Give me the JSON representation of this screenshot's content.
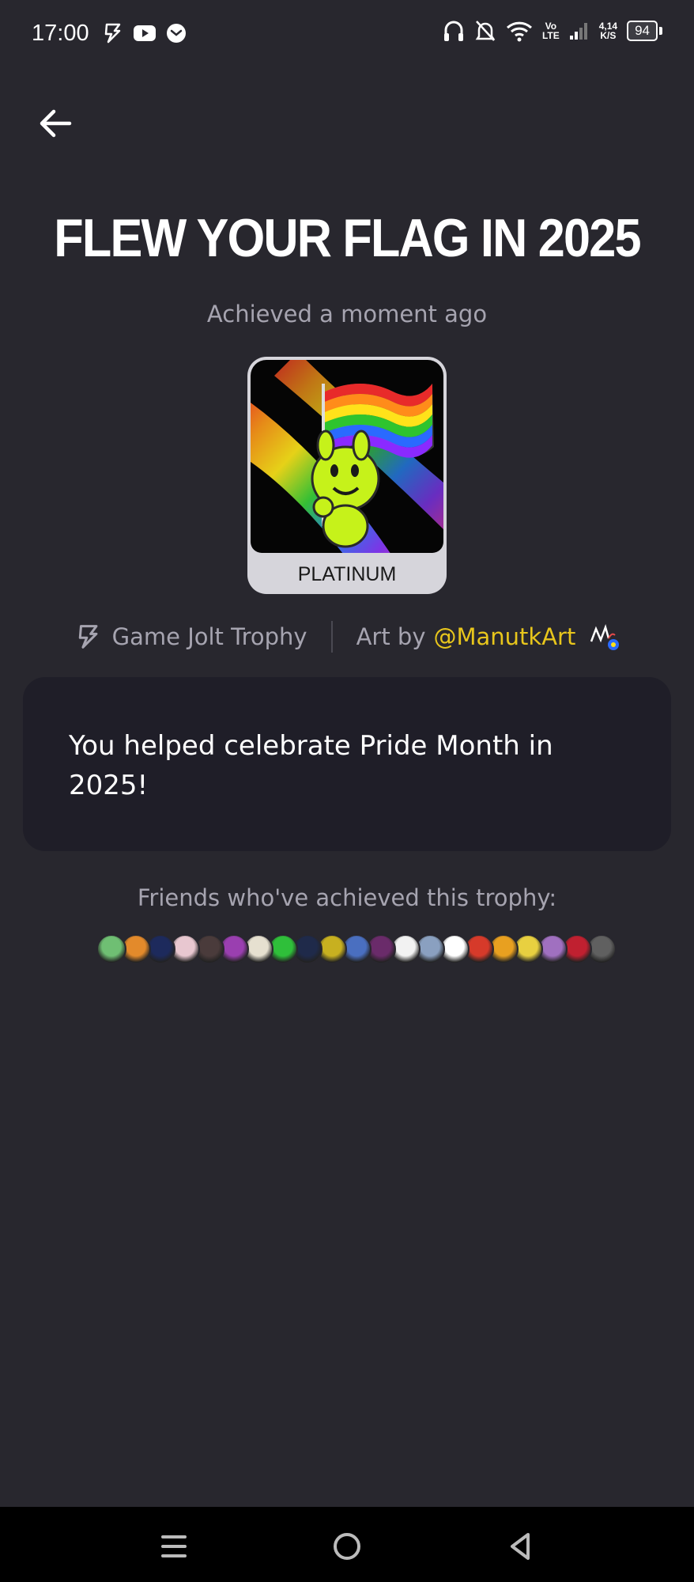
{
  "status_bar": {
    "time": "17:00",
    "network_label_top": "Vo",
    "network_label_bottom": "LTE",
    "speed_value": "4,14",
    "speed_unit": "K/S",
    "battery": "94"
  },
  "header": {
    "title": "FLEW YOUR FLAG IN 2025",
    "achieved": "Achieved a moment ago"
  },
  "trophy": {
    "tier": "PLATINUM",
    "source": "Game Jolt Trophy",
    "art_by_prefix": "Art by",
    "artist": "@ManutkArt",
    "description": "You helped celebrate Pride Month in 2025!"
  },
  "friends": {
    "label": "Friends who've achieved this trophy:",
    "avatar_colors": [
      "#6fbf73",
      "#e38a2b",
      "#1d2a5c",
      "#e8c7d0",
      "#4a3b3b",
      "#9a3fb0",
      "#e6e0d0",
      "#2fbf3a",
      "#1f2a4a",
      "#c7b020",
      "#4a6fc0",
      "#6a2b6a",
      "#f2f2f2",
      "#8aa0c0",
      "#ffffff",
      "#d63a2a",
      "#e8a020",
      "#e8d040",
      "#a070c0",
      "#c02030",
      "#606060"
    ]
  },
  "nav": {
    "menu_icon": "menu-icon",
    "home_icon": "home-circle-icon",
    "back_icon": "back-triangle-icon"
  }
}
